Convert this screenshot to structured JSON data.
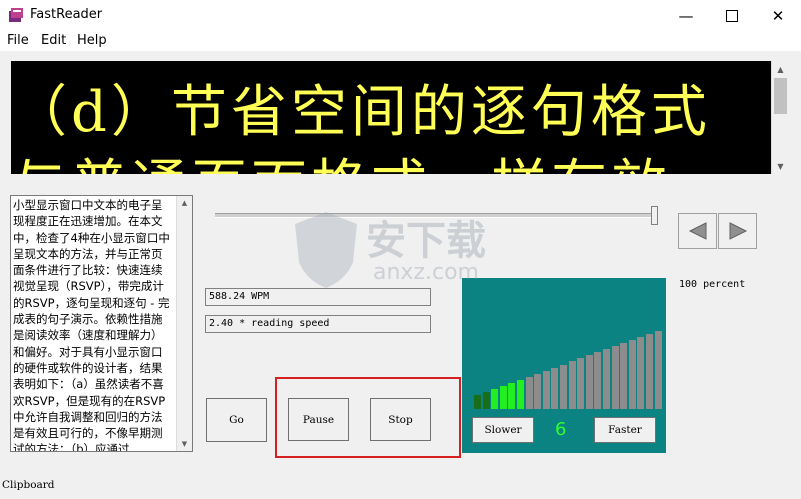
{
  "window": {
    "title": "FastReader"
  },
  "menu": [
    "File",
    "Edit",
    "Help"
  ],
  "display": {
    "line1": "（d）节省空间的逐句格式",
    "line2": "与普通页面格式一样有效"
  },
  "text_pane": {
    "content": "小型显示窗口中文本的电子呈现程度正在迅速增加。在本文中，检查了4种在小显示窗口中呈现文本的方法，并与正常页面条件进行了比较：快速连续视觉呈现（RSVP），带完成计的RSVP，逐句呈现和逐句 - 完成表的句子演示。依赖性措施是阅读效率（速度和理解力）和偏好。对于具有小显示窗口的硬件或软件的设计者，结果表明如下：（a）虽然读者不喜欢RSVP，但是现有的在RSVP中允许自我调整和回归的方法是有效且可行的，不像早期测试的方法；（b）应通过"
  },
  "slider": {
    "value_percent": 100
  },
  "readouts": {
    "wpm": "588.24 WPM",
    "reading_speed": "2.40 * reading speed",
    "percent": "100 percent"
  },
  "buttons": {
    "go": "Go",
    "pause": "Pause",
    "stop": "Stop",
    "slower": "Slower",
    "faster": "Faster"
  },
  "speed": {
    "level": "6",
    "bars_total": 22,
    "bars_active": 6,
    "active_color": "#22ee22",
    "dim_color": "#1a6e1a",
    "inactive_color": "#8c8c8c"
  },
  "status": {
    "text": "Clipboard"
  },
  "watermark": {
    "text": "安下载",
    "sub": "anxz.com"
  },
  "colors": {
    "display_bg": "#000000",
    "display_text": "#ffff55",
    "panel": "#0c8383",
    "highlight": "#d42020"
  }
}
